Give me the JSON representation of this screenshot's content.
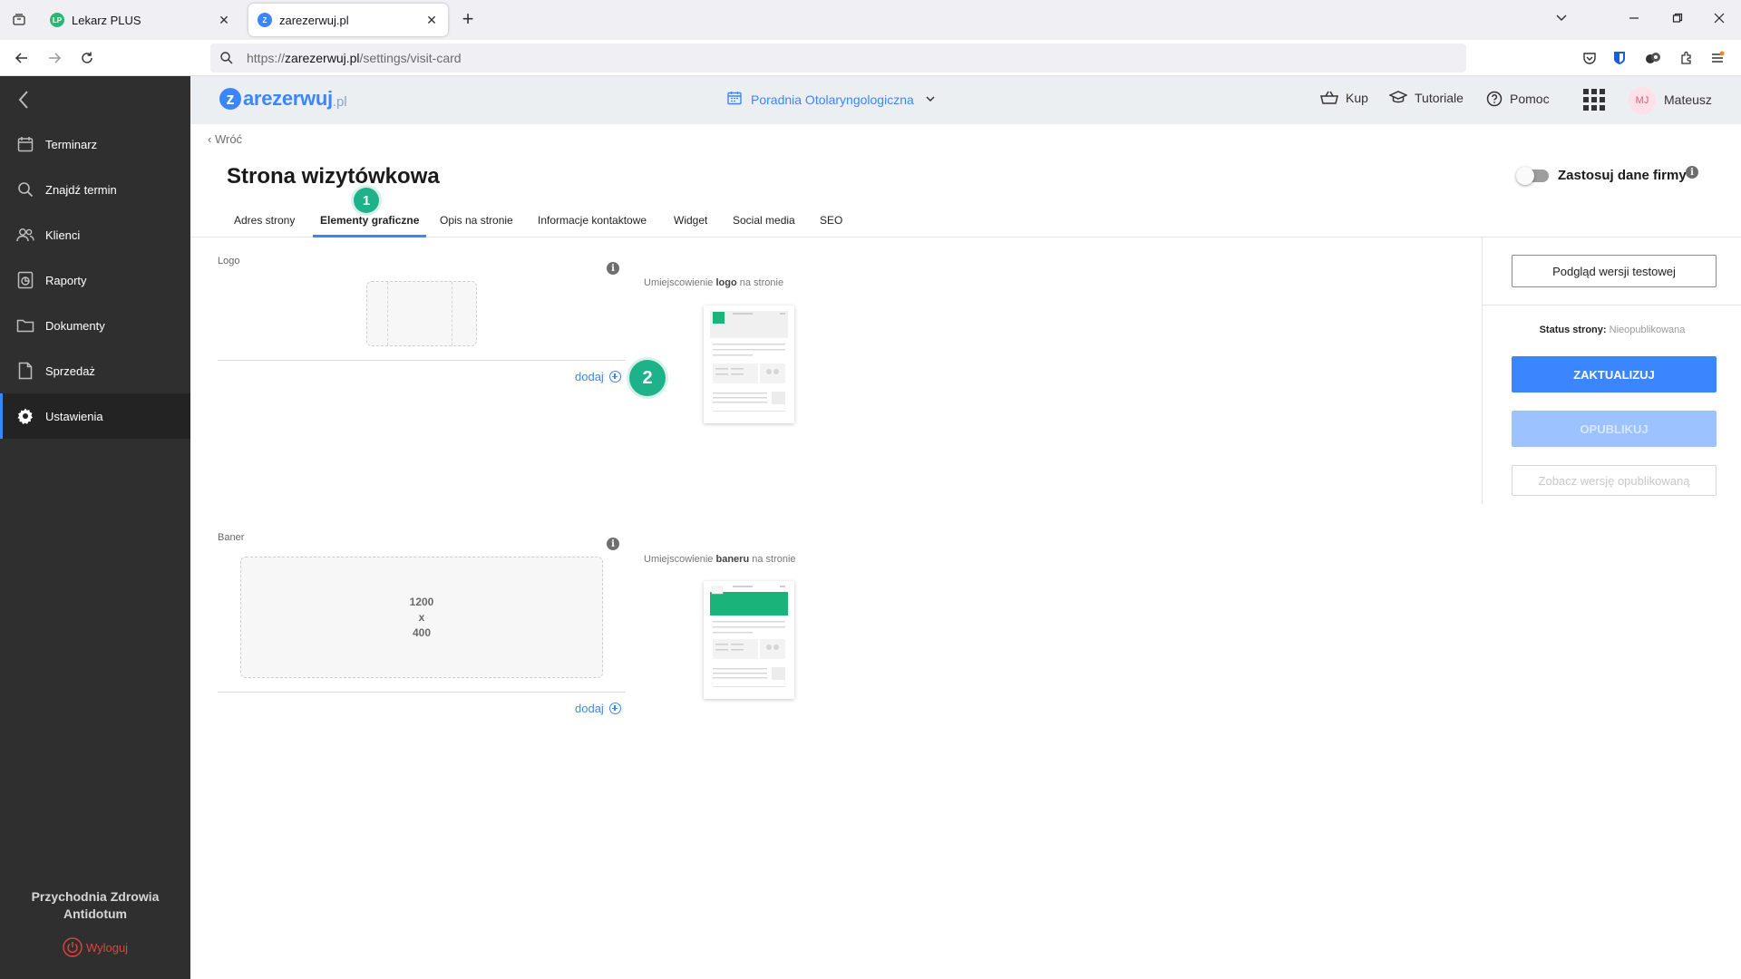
{
  "browser": {
    "tabs": [
      {
        "title": "Lekarz PLUS",
        "favicon": "LP",
        "favicon_color": "#2bb673"
      },
      {
        "title": "zarezerwuj.pl",
        "favicon": "Z",
        "favicon_color": "#3b86ff"
      }
    ],
    "url": {
      "prefix": "https://",
      "host": "zarezerwuj.pl",
      "path": "/settings/visit-card"
    }
  },
  "sidebar": {
    "items": [
      {
        "label": "Terminarz",
        "icon": "calendar-icon"
      },
      {
        "label": "Znajdź termin",
        "icon": "search-icon"
      },
      {
        "label": "Klienci",
        "icon": "users-icon"
      },
      {
        "label": "Raporty",
        "icon": "report-icon"
      },
      {
        "label": "Dokumenty",
        "icon": "folder-icon"
      },
      {
        "label": "Sprzedaż",
        "icon": "document-icon"
      },
      {
        "label": "Ustawienia",
        "icon": "gear-icon"
      }
    ],
    "active_index": 6,
    "organization": {
      "line1": "Przychodnia Zdrowia",
      "line2": "Antidotum"
    },
    "logout_label": "Wyloguj"
  },
  "header": {
    "brand": {
      "z": "z",
      "name": "arezerwuj",
      "tld": ".pl"
    },
    "clinic": "Poradnia Otolaryngologiczna",
    "links": {
      "buy": "Kup",
      "tutorials": "Tutoriale",
      "help": "Pomoc"
    },
    "user": {
      "initials": "MJ",
      "name": "Mateusz"
    }
  },
  "page": {
    "back_label": "Wróć",
    "title": "Strona wizytówkowa",
    "toggle_label": "Zastosuj dane firmy",
    "tabs": [
      "Adres strony",
      "Elementy graficzne",
      "Opis na stronie",
      "Informacje kontaktowe",
      "Widget",
      "Social media",
      "SEO"
    ],
    "active_tab": 1,
    "badges": [
      "1",
      "2"
    ]
  },
  "logo_section": {
    "label": "Logo",
    "placement_pre": "Umiejscowienie",
    "placement_bold": "logo",
    "placement_post": "na stronie",
    "add_label": "dodaj"
  },
  "banner_section": {
    "label": "Baner",
    "placement_pre": "Umiejscowienie",
    "placement_bold": "baneru",
    "placement_post": "na stronie",
    "size_w": "1200",
    "size_x": "x",
    "size_h": "400",
    "add_label": "dodaj"
  },
  "right_panel": {
    "preview_button": "Podgląd wersji testowej",
    "status_key": "Status strony:",
    "status_value": "Nieopublikowana",
    "update_button": "ZAKTUALIZUJ",
    "publish_button": "OPUBLIKUJ",
    "view_published_button": "Zobacz wersję opublikowaną"
  },
  "colors": {
    "accent": "#3b86ff",
    "badge": "#1db28a",
    "sidebar_bg": "#2f2f2f",
    "thumb_green": "#1ab37a"
  }
}
